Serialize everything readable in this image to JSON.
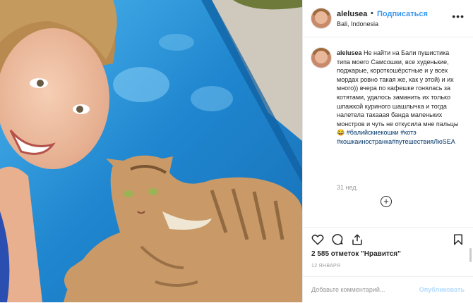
{
  "post": {
    "username": "alelusea",
    "separator": "•",
    "follow_label": "Подписаться",
    "location": "Bali, Indonesia",
    "more_icon": "more-horizontal-icon"
  },
  "caption": {
    "username": "alelusea",
    "text": "Не найти на Бали пушистика типа моего Самсошки, все худенькие, поджарые, короткошёрстные и у всех мордах ровно такая же, как у этой) и их много)) вчера по кафешке гонялась за котятами, удалось заманить их только шпажкой куриного шашлычка и тогда налетела такааая банда маленьких монстров и чуть не откусила мне пальцы😂",
    "hashtags": "#балийскиекошки #котэ #кошкаиностранка#путешествияЛюSEA",
    "age": "31 нед."
  },
  "actions": {
    "like_icon": "heart-icon",
    "comment_icon": "comment-icon",
    "share_icon": "share-icon",
    "save_icon": "bookmark-icon"
  },
  "likes": "2 585 отметок \"Нравится\"",
  "date": "12 ЯНВАРЯ",
  "comment_box": {
    "placeholder": "Добавьте комментарий...",
    "post_label": "Опубликовать"
  },
  "colors": {
    "accent": "#3897f0",
    "hashtag": "#003569",
    "photo_blue": "#2a8fd0"
  }
}
